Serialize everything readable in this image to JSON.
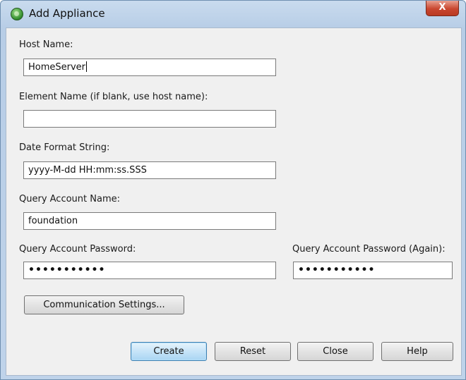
{
  "window": {
    "title": "Add Appliance",
    "close_glyph": "X"
  },
  "form": {
    "host_name": {
      "label": "Host Name:",
      "value": "HomeServer"
    },
    "element_name": {
      "label": "Element Name (if blank, use host name):",
      "value": ""
    },
    "date_format": {
      "label": "Date Format String:",
      "value": "yyyy-M-dd HH:mm:ss.SSS"
    },
    "query_account_name": {
      "label": "Query Account Name:",
      "value": "foundation"
    },
    "query_account_password": {
      "label": "Query Account Password:",
      "value": "•••••••••••"
    },
    "query_account_password_again": {
      "label": "Query Account Password (Again):",
      "value": "•••••••••••"
    }
  },
  "buttons": {
    "communication_settings": "Communication Settings...",
    "create": "Create",
    "reset": "Reset",
    "close": "Close",
    "help": "Help"
  },
  "icons": {
    "app_icon": "green-globe-icon",
    "close": "close-icon"
  }
}
